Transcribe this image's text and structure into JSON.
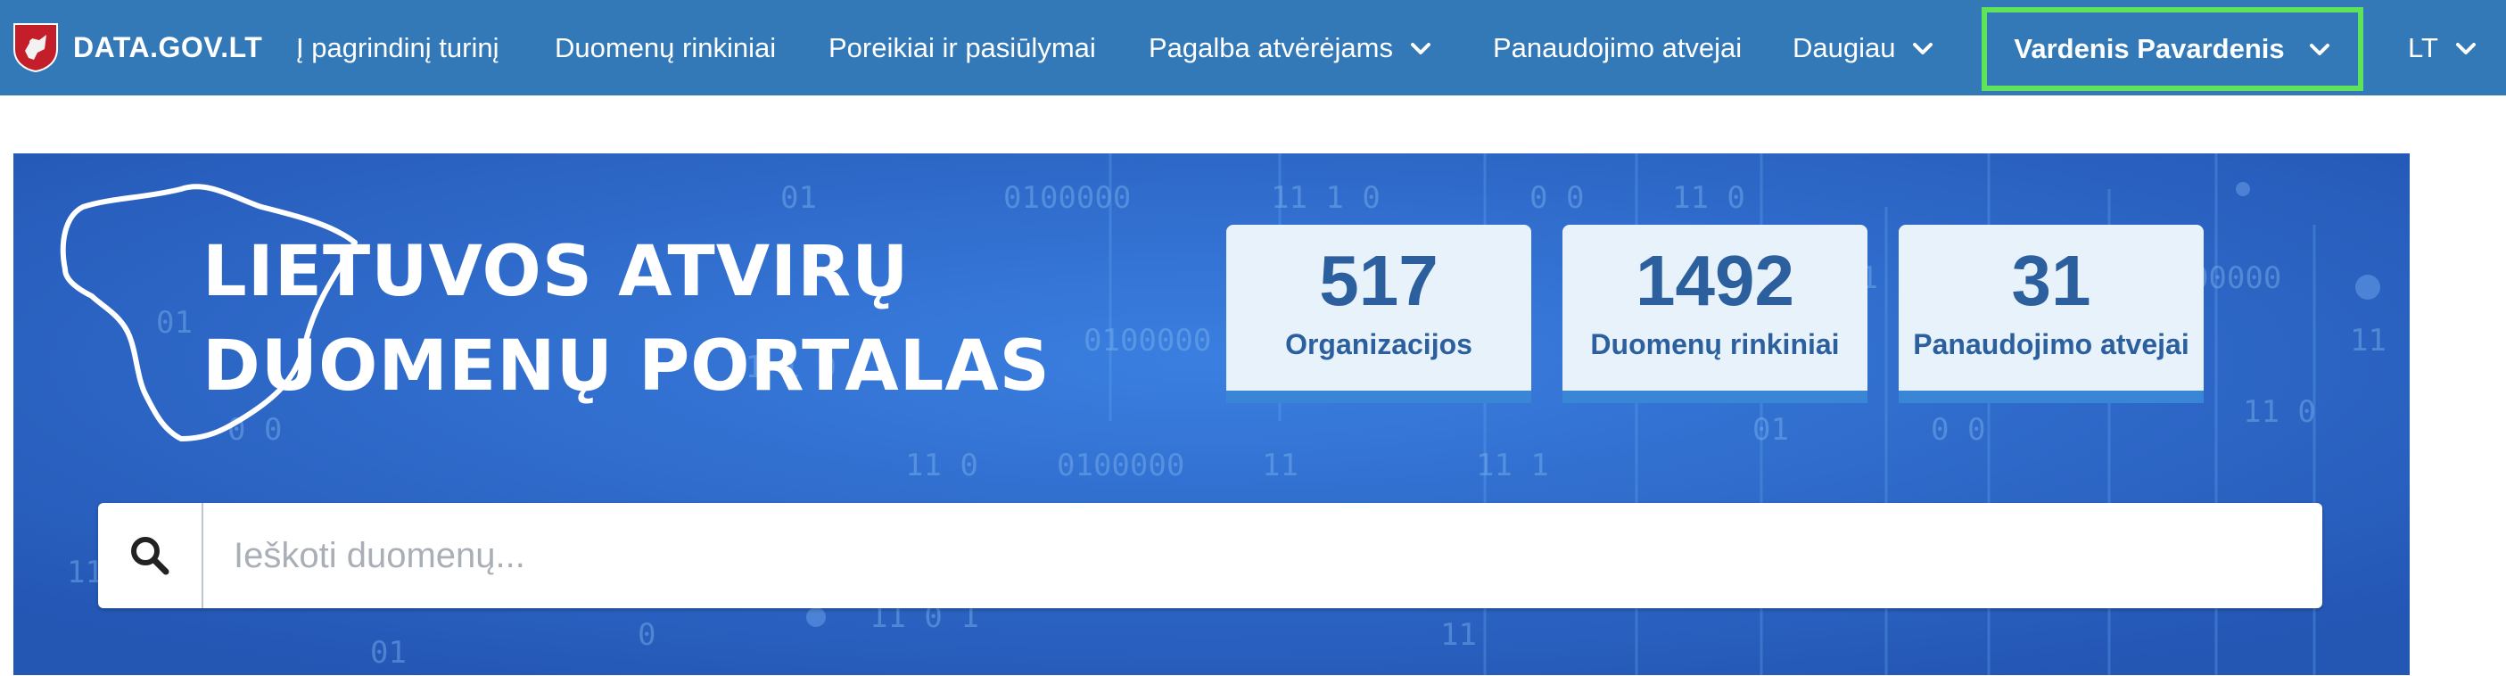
{
  "navbar": {
    "brand": "DATA.GOV.LT",
    "items": [
      {
        "label": "Į pagrindinį turinį",
        "has_dropdown": false
      },
      {
        "label": "Duomenų rinkiniai",
        "has_dropdown": false
      },
      {
        "label": "Poreikiai ir pasiūlymai",
        "has_dropdown": false
      },
      {
        "label": "Pagalba atvėrėjams",
        "has_dropdown": true
      },
      {
        "label": "Panaudojimo atvejai",
        "has_dropdown": false
      },
      {
        "label": "Daugiau",
        "has_dropdown": true
      }
    ],
    "user_name": "Vardenis Pavardenis",
    "language": "LT",
    "colors": {
      "background": "#3379b8",
      "highlight_border": "#5fe35a"
    }
  },
  "hero": {
    "title_line1": "LIETUVOS ATVIRŲ",
    "title_line2": "DUOMENŲ PORTALAS",
    "stats": [
      {
        "value": "517",
        "label": "Organizacijos"
      },
      {
        "value": "1492",
        "label": "Duomenų rinkiniai"
      },
      {
        "value": "31",
        "label": "Panaudojimo atvejai"
      }
    ],
    "background_digits": [
      "01",
      "0100000",
      "11 1 0",
      "0 0",
      "11 0",
      "01",
      "0100000",
      "11 1 0",
      "0 0",
      "11 0",
      "0100000",
      "11",
      "11 1",
      "01",
      "0 0",
      "11 0",
      "11",
      "01",
      "0100000",
      "11 1 0",
      "0",
      "11 0 1",
      "11",
      "1000",
      "11 1 0",
      "0 0",
      "01"
    ],
    "colors": {
      "background": "#2a62c0",
      "card": "#e8f2fb",
      "card_accent": "#3a86d6",
      "card_text": "#2c5f9e"
    }
  },
  "search": {
    "placeholder": "Ieškoti duomenų...",
    "value": "",
    "icon": "search-icon"
  }
}
